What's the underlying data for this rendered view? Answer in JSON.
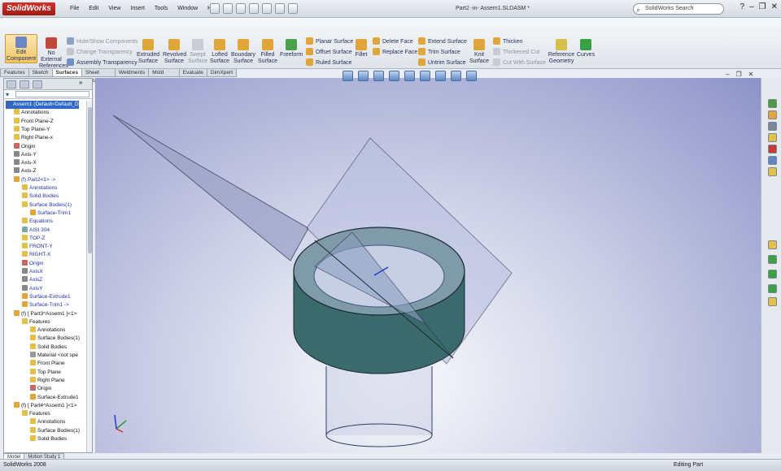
{
  "app": {
    "logo": "SolidWorks",
    "document_title": "Part2 -in- Assem1.SLDASM *"
  },
  "menu": [
    "File",
    "Edit",
    "View",
    "Insert",
    "Tools",
    "Window",
    "Help"
  ],
  "search": {
    "placeholder": "SolidWorks Search"
  },
  "ribbon": {
    "edit_component": "Edit Component",
    "no_external_refs": "No External References",
    "hide_show": "Hide/Show Components",
    "change_transparency": "Change Transparency",
    "assembly_transparency": "Assembly Transparency",
    "extruded": "Extruded Surface",
    "revolved": "Revolved Surface",
    "swept": "Swept Surface",
    "lofted": "Lofted Surface",
    "boundary": "Boundary Surface",
    "filled": "Filled Surface",
    "freeform": "Freeform",
    "planar": "Planar Surface",
    "offset": "Offset Surface",
    "ruled": "Ruled Surface",
    "fillet": "Fillet",
    "delete_face": "Delete Face",
    "replace_face": "Replace Face",
    "extend": "Extend Surface",
    "trim": "Trim Surface",
    "untrim": "Untrim Surface",
    "knit": "Knit Surface",
    "thicken": "Thicken",
    "thickened_cut": "Thickened Cut",
    "cut_with_surface": "Cut With Surface",
    "reference_geometry": "Reference Geometry",
    "curves": "Curves"
  },
  "tabs": [
    "Features",
    "Sketch",
    "Surfaces",
    "Sheet Metal",
    "Weldments",
    "Mold Tools",
    "Evaluate",
    "DimXpert"
  ],
  "tree": [
    "Assem1 (Default<Default_D",
    "Annotations",
    "Front Plane-Z",
    "Top Plane-Y",
    "Right Plane-x",
    "Origin",
    "Axis-Y",
    "Axis-X",
    "Axis-Z",
    "(f) Part2<1> ->",
    "Annotations",
    "Solid Bodies",
    "Surface Bodies(1)",
    "Surface-Trim1",
    "Equations",
    "AISI 304",
    "TOP-Z",
    "FRONT-Y",
    "RIGHT-X",
    "Origin",
    "AxisX",
    "AxisZ",
    "AxisY",
    "Surface-Extrude1",
    "Surface-Trim1 ->",
    "(f) [ Part3^Assem1 ]<1>",
    "Features",
    "Annotations",
    "Surface Bodies(1)",
    "Solid Bodies",
    "Material <not spe",
    "Front Plane",
    "Top Plane",
    "Right Plane",
    "Origin",
    "Surface-Extrude1",
    "(f) [ Part4^Assem1 ]<1>",
    "Features",
    "Annotations",
    "Surface Bodies(1)",
    "Solid Bodies"
  ],
  "bottom_tabs": [
    "Model",
    "Motion Study 1"
  ],
  "status": {
    "left": "SolidWorks 2008",
    "right": "Editing Part"
  }
}
